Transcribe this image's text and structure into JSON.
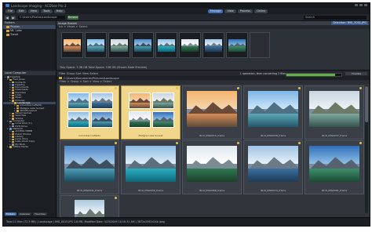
{
  "window": {
    "title": "Landscape Imaging - ACDSee Pro 3"
  },
  "toolbar": {
    "buttons": [
      "File",
      "Edit",
      "View",
      "Tools",
      "Help",
      "Manage",
      "View",
      "Process",
      "Online"
    ]
  },
  "nav": {
    "path": "C:\\Users\\Photos\\Landscape",
    "go_label": "Browse",
    "search_placeholder": "Search"
  },
  "folders_top": {
    "header": "Folders",
    "items": [
      {
        "label": "Photos",
        "selected": true
      },
      {
        "label": "Mt. Lake",
        "selected": false
      },
      {
        "label": "Travel",
        "selected": false
      }
    ]
  },
  "tray": {
    "header": "Image Basket",
    "sub": "Ice > Views > Select",
    "right_info": "Selection: IMG_3041.JPG",
    "status": "Tray Space: 1.36 GB  Total Space: 136 GB  (Shown Date Preview)"
  },
  "left_panel": {
    "header": "Local Computer",
    "tree": [
      {
        "label": "Desktop",
        "indent": 0,
        "icon": "drive"
      },
      {
        "label": "Fred Jones",
        "indent": 1,
        "icon": "folder"
      },
      {
        "label": "Contacts",
        "indent": 2,
        "icon": "folder"
      },
      {
        "label": "Desktop",
        "indent": 2,
        "icon": "blue"
      },
      {
        "label": "Documents",
        "indent": 2,
        "icon": "folder"
      },
      {
        "label": "Downloads",
        "indent": 2,
        "icon": "folder"
      },
      {
        "label": "Favorites",
        "indent": 2,
        "icon": "folder"
      },
      {
        "label": "Links",
        "indent": 2,
        "icon": "folder"
      },
      {
        "label": "Music",
        "indent": 2,
        "icon": "folder"
      },
      {
        "label": "Pictures",
        "indent": 2,
        "icon": "folder"
      },
      {
        "label": "Landscape",
        "indent": 3,
        "icon": "folder",
        "selected": true
      },
      {
        "label": "Columbia Icefields",
        "indent": 4,
        "icon": "folder"
      },
      {
        "label": "Maligne Lake Sunset",
        "indent": 4,
        "icon": "folder"
      },
      {
        "label": "Wildlife Iqaluit",
        "indent": 4,
        "icon": "folder"
      },
      {
        "label": "Saved Games",
        "indent": 2,
        "icon": "folder"
      },
      {
        "label": "Searches",
        "indent": 2,
        "icon": "folder"
      },
      {
        "label": "Videos",
        "indent": 2,
        "icon": "folder"
      },
      {
        "label": "Computer",
        "indent": 1,
        "icon": "drive"
      },
      {
        "label": "Local Disk (C:)",
        "indent": 2,
        "icon": "drive"
      },
      {
        "label": "DVD Drive",
        "indent": 2,
        "icon": "drive"
      },
      {
        "label": "Network",
        "indent": 1,
        "icon": "blue"
      },
      {
        "label": "ACCESS HMRB",
        "indent": 2,
        "icon": "folder"
      },
      {
        "label": "Public Photos",
        "indent": 2,
        "icon": "folder"
      },
      {
        "label": "Library",
        "indent": 2,
        "icon": "folder"
      },
      {
        "label": "Jump drive",
        "indent": 2,
        "icon": "folder"
      },
      {
        "label": "Lake shoot Copy",
        "indent": 2,
        "icon": "folder"
      },
      {
        "label": "My Book",
        "indent": 2,
        "icon": "drive"
      },
      {
        "label": "Offline Media",
        "indent": 1,
        "icon": "folder"
      }
    ],
    "tabs": [
      {
        "label": "Folders",
        "active": true
      },
      {
        "label": "Calendar",
        "active": false
      },
      {
        "label": "Favorites",
        "active": false
      }
    ]
  },
  "main": {
    "queue_info": "Filter  Group  Sort  View  Select",
    "progress_label": "1 operation, then converting 3 files",
    "progress": 0.88,
    "view_mode": "Thumbs",
    "address": "C:\\Users\\Documents\\Pictures\\Landscape",
    "crumb": "Filter > Group > Sort > View > Select",
    "items": [
      {
        "caption": "Columbia Icefields",
        "type": "folder"
      },
      {
        "caption": "Maligne Lake Sunset",
        "type": "folder"
      },
      {
        "caption": "Illicit_IMG0015_frame",
        "type": "photo",
        "palette": "p1"
      },
      {
        "caption": "Illicit_IMG0028_frame",
        "type": "photo",
        "palette": "p2"
      },
      {
        "caption": "Illicit_IMG0037_frame",
        "type": "photo",
        "palette": "p3"
      },
      {
        "caption": "Illicit_IMG0041_frame",
        "type": "photo",
        "palette": "p4"
      },
      {
        "caption": "Illicit_IMG0052_frame",
        "type": "photo",
        "palette": "p5"
      },
      {
        "caption": "Illicit_IMG0066_frame",
        "type": "photo",
        "palette": "p6"
      },
      {
        "caption": "Illicit_IMG0073_frame",
        "type": "photo",
        "palette": "p7"
      },
      {
        "caption": "Illicit_IMG0081_frame",
        "type": "photo",
        "palette": "p8"
      },
      {
        "caption": "",
        "type": "photo",
        "palette": "p9"
      }
    ]
  },
  "status": {
    "text": "Total 11 files (72.3 MB)  |  Landscape  |  IMG_0015.JPG  1.8 MB, Modified Date: 3/25/2009 10:10:31 AM  |  3872x2592x24b jpeg"
  },
  "colors": {
    "accent": "#3f6fb5",
    "folder": "#d7a63a",
    "selection": "#3b4a5e",
    "progress": "#5fb048"
  }
}
